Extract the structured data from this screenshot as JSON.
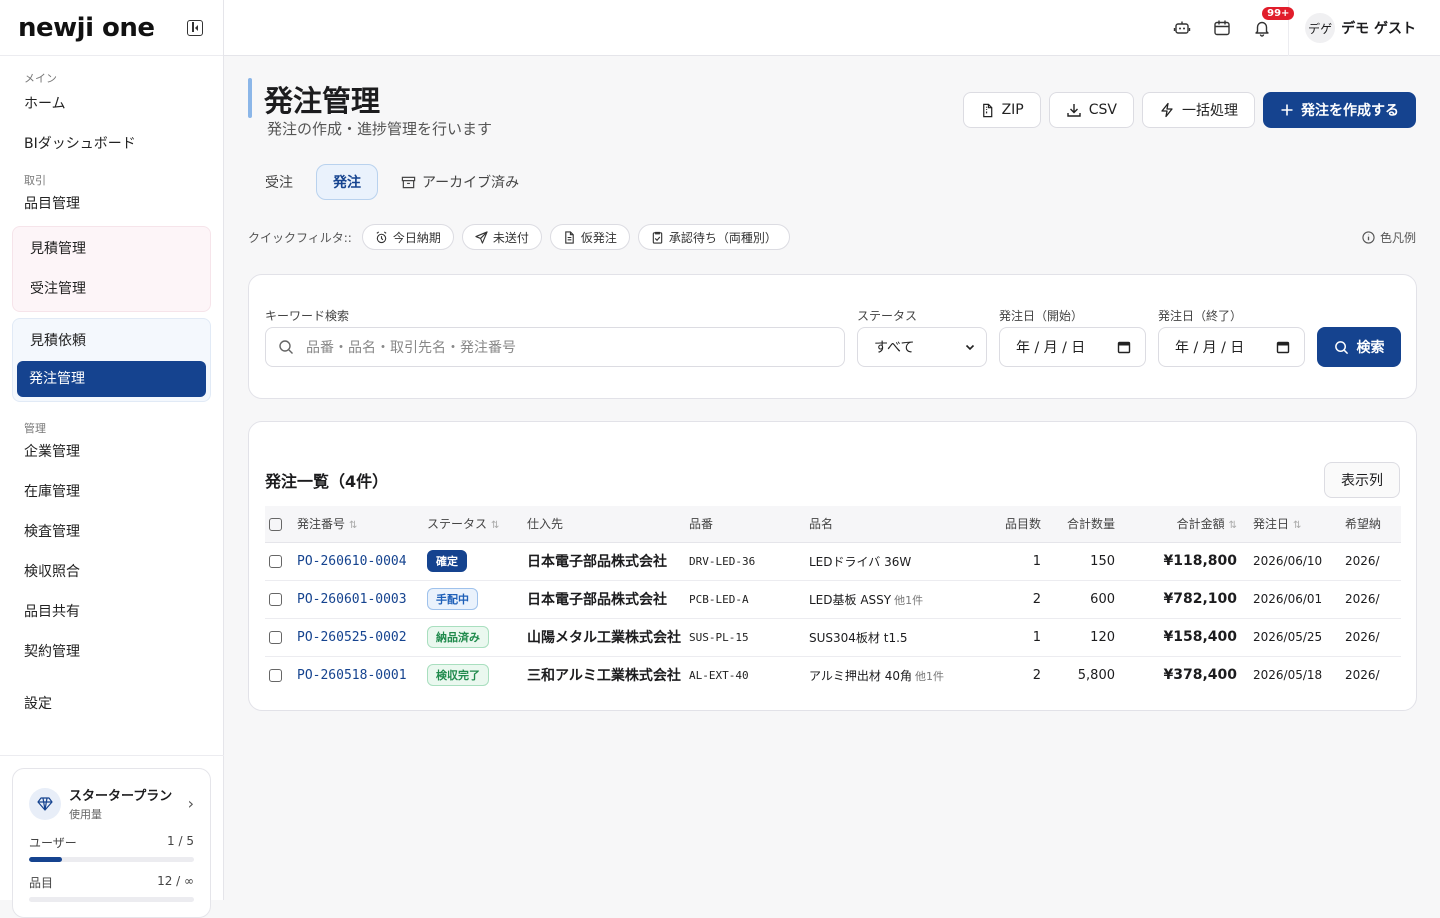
{
  "brand": "newji one",
  "sidebar": {
    "section_main": "メイン",
    "home": "ホーム",
    "bi": "BIダッシュボード",
    "section_trade": "取引",
    "items_master": "品目管理",
    "quote": "見積管理",
    "order_received": "受注管理",
    "quote_request": "見積依頼",
    "purchase": "発注管理",
    "section_admin": "管理",
    "company": "企業管理",
    "inventory": "在庫管理",
    "inspection": "検査管理",
    "receiving": "検収照合",
    "item_share": "品目共有",
    "contract": "契約管理",
    "settings": "設定"
  },
  "plan": {
    "name": "スタータープラン",
    "usage_label": "使用量",
    "users_label": "ユーザー",
    "users_value": "1 / 5",
    "users_fraction": 0.2,
    "items_label": "品目",
    "items_value": "12 / ∞",
    "items_fraction": 0.0
  },
  "topbar": {
    "notification_badge": "99+",
    "avatar_text": "デゲ",
    "user_name": "デモ ゲスト"
  },
  "page": {
    "title": "発注管理",
    "subtitle": "発注の作成・進捗管理を行います",
    "btn_zip": "ZIP",
    "btn_csv": "CSV",
    "btn_bulk": "一括処理",
    "btn_create": "発注を作成する"
  },
  "tabs": {
    "received": "受注",
    "ordered": "発注",
    "archived": "アーカイブ済み"
  },
  "quick_filter": {
    "label": "クイックフィルタ::",
    "today_due": "今日納期",
    "unsent": "未送付",
    "tentative": "仮発注",
    "pending_approval": "承認待ち（両種別）",
    "legend": "色凡例"
  },
  "search": {
    "keyword_label": "キーワード検索",
    "keyword_placeholder": "品番・品名・取引先名・発注番号",
    "status_label": "ステータス",
    "status_value": "すべて",
    "date_from_label": "発注日（開始）",
    "date_from_value": "年 / 月 / 日",
    "date_to_label": "発注日（終了）",
    "date_to_value": "年 / 月 / 日",
    "search_btn": "検索"
  },
  "list": {
    "title": "発注一覧（4件）",
    "columns_btn": "表示列",
    "headers": {
      "po_no": "発注番号",
      "status": "ステータス",
      "supplier": "仕入先",
      "part_no": "品番",
      "part_name": "品名",
      "item_count": "品目数",
      "total_qty": "合計数量",
      "total_amount": "合計金額",
      "order_date": "発注日",
      "desired": "希望納"
    },
    "rows": [
      {
        "po_no": "PO-260610-0004",
        "status": "確定",
        "supplier": "日本電子部品株式会社",
        "part_no": "DRV-LED-36",
        "part_name": "LEDドライバ 36W",
        "extra": "",
        "item_count": "1",
        "total_qty": "150",
        "total_amount": "¥118,800",
        "order_date": "2026/06/10",
        "desired": "2026/"
      },
      {
        "po_no": "PO-260601-0003",
        "status": "手配中",
        "supplier": "日本電子部品株式会社",
        "part_no": "PCB-LED-A",
        "part_name": "LED基板 ASSY",
        "extra": "他1件",
        "item_count": "2",
        "total_qty": "600",
        "total_amount": "¥782,100",
        "order_date": "2026/06/01",
        "desired": "2026/"
      },
      {
        "po_no": "PO-260525-0002",
        "status": "納品済み",
        "supplier": "山陽メタル工業株式会社",
        "part_no": "SUS-PL-15",
        "part_name": "SUS304板材 t1.5",
        "extra": "",
        "item_count": "1",
        "total_qty": "120",
        "total_amount": "¥158,400",
        "order_date": "2026/05/25",
        "desired": "2026/"
      },
      {
        "po_no": "PO-260518-0001",
        "status": "検収完了",
        "supplier": "三和アルミ工業株式会社",
        "part_no": "AL-EXT-40",
        "part_name": "アルミ押出材 40角",
        "extra": "他1件",
        "item_count": "2",
        "total_qty": "5,800",
        "total_amount": "¥378,400",
        "order_date": "2026/05/18",
        "desired": "2026/"
      }
    ]
  },
  "status_colors": {
    "確定": {
      "bg": "#15438f",
      "fg": "#ffffff",
      "border": "#15438f"
    },
    "手配中": {
      "bg": "#eaf2fc",
      "fg": "#1d5fb8",
      "border": "#9fc2ec"
    },
    "納品済み": {
      "bg": "#eaf8ef",
      "fg": "#1f8a4c",
      "border": "#a9dfbf"
    },
    "検収完了": {
      "bg": "#eaf8ef",
      "fg": "#1f8a4c",
      "border": "#a9dfbf"
    }
  }
}
